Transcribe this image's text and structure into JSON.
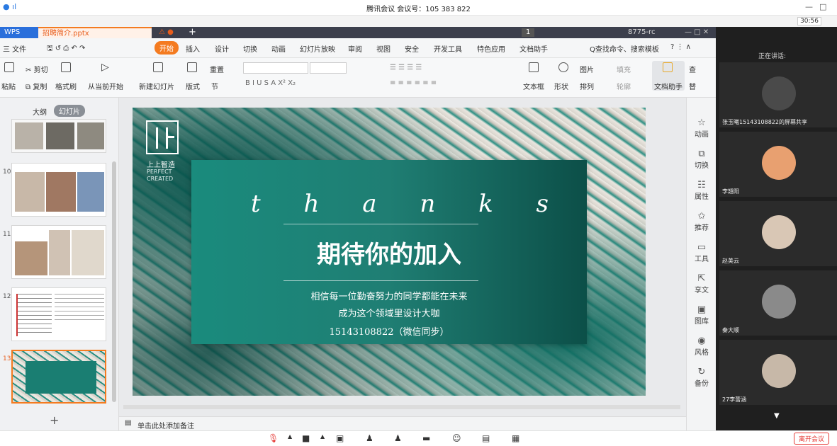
{
  "meeting": {
    "title": "腾讯会议 会议号：105 383 822",
    "timer": "30:56",
    "leave": "离开会议",
    "speaking_label": "正在讲话:"
  },
  "wps": {
    "app_tab": "WPS",
    "file_tab": "招聘简介.pptx",
    "tab_add": "+",
    "badge": "1",
    "account": "8775-rc",
    "menu": [
      "三 文件",
      "开始",
      "插入",
      "设计",
      "切换",
      "动画",
      "幻灯片放映",
      "审阅",
      "视图",
      "安全",
      "开发工具",
      "特色应用",
      "文档助手"
    ],
    "search": "Q查找命令、搜索模板",
    "ribbon": {
      "cut": "剪切",
      "paste": "粘贴",
      "copy": "复制",
      "format_painter": "格式刷",
      "from_current": "从当前开始",
      "new_slide": "新建幻灯片",
      "layout": "版式",
      "section": "节",
      "reset": "重置",
      "textbox": "文本框",
      "shape": "形状",
      "picture": "图片",
      "fill": "填充",
      "arrange": "排列",
      "outline": "轮廓",
      "doc_helper": "文档助手",
      "find": "查",
      "replace": "替"
    },
    "left_tabs": [
      "大纲",
      "幻灯片"
    ],
    "slide_numbers": [
      "10",
      "11",
      "12",
      "13"
    ],
    "notes_placeholder": "单击此处添加备注",
    "add_slide": "+"
  },
  "slide": {
    "logo_line1": "上上智造",
    "logo_line2": "PERFECT",
    "logo_line3": "CREATED",
    "thanks_letters": [
      "t",
      "h",
      "a",
      "n",
      "k",
      "s"
    ],
    "headline": "期待你的加入",
    "line1": "相信每一位勤奋努力的同学都能在未来",
    "line2": "成为这个领域里设计大咖",
    "line3": "15143108822（微信同步）"
  },
  "sidetools": [
    "动画",
    "切换",
    "属性",
    "推荐",
    "工具",
    "享文",
    "图库",
    "风格",
    "备份"
  ],
  "participants": [
    {
      "name": "张玉曦15143108822的屏幕共享",
      "color": "#333333"
    },
    {
      "name": "李翘阳",
      "color": "#e8a070"
    },
    {
      "name": "赵美云",
      "color": "#d9c7b5"
    },
    {
      "name": "秦大顺",
      "color": "#8a8a8a"
    },
    {
      "name": "27李蕾涵",
      "color": "#c7b8a8"
    }
  ],
  "colors": {
    "accent": "#1a8b7d",
    "wps_orange": "#f47b20",
    "dark": "#1f1f1f"
  }
}
